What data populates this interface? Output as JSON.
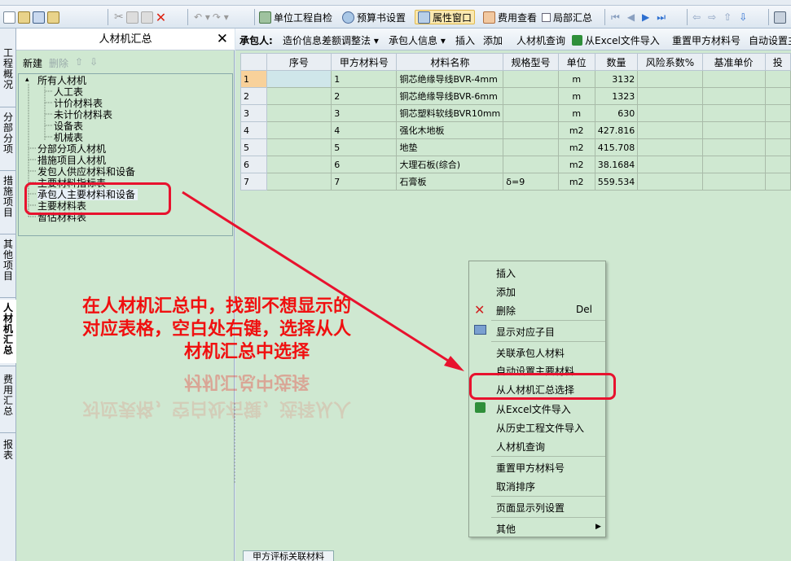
{
  "toolbar": {
    "items": [
      "单位工程自检",
      "预算书设置",
      "属性窗口",
      "费用查看",
      "局部汇总"
    ]
  },
  "side_tabs": [
    "工程概况",
    "分部分项",
    "措施项目",
    "其他项目",
    "人材机汇总",
    "费用汇总",
    "报表"
  ],
  "left_panel": {
    "title": "人材机汇总",
    "close": "✕",
    "new_label": "新建",
    "delete_label": "删除",
    "tree": {
      "root": "所有人材机",
      "children": [
        "人工表",
        "计价材料表",
        "未计价材料表",
        "设备表",
        "机械表"
      ],
      "items": [
        "分部分项人材机",
        "措施项目人材机",
        "发包人供应材料和设备",
        "主要材料指标表",
        "承包人主要材料和设备",
        "主要材料表",
        "暂估材料表"
      ]
    }
  },
  "right_toolbar": {
    "prefix": "承包人:",
    "items": [
      "造价信息差额调整法",
      "承包人信息",
      "插入",
      "添加",
      "人材机查询",
      "从Excel文件导入",
      "重置甲方材料号",
      "自动设置主"
    ]
  },
  "table": {
    "headers": [
      "序号",
      "甲方材料号",
      "材料名称",
      "规格型号",
      "单位",
      "数量",
      "风险系数%",
      "基准单价",
      "投"
    ],
    "rows": [
      {
        "n": "1",
        "code": "1",
        "name": "铜芯绝缘导线BVR-4mm",
        "spec": "",
        "unit": "m",
        "qty": "3132"
      },
      {
        "n": "2",
        "code": "2",
        "name": "铜芯绝缘导线BVR-6mm",
        "spec": "",
        "unit": "m",
        "qty": "1323"
      },
      {
        "n": "3",
        "code": "3",
        "name": "铜芯塑料软线BVR10mm",
        "spec": "",
        "unit": "m",
        "qty": "630"
      },
      {
        "n": "4",
        "code": "4",
        "name": "强化木地板",
        "spec": "",
        "unit": "m2",
        "qty": "427.816"
      },
      {
        "n": "5",
        "code": "5",
        "name": "地垫",
        "spec": "",
        "unit": "m2",
        "qty": "415.708"
      },
      {
        "n": "6",
        "code": "6",
        "name": "大理石板(综合)",
        "spec": "",
        "unit": "m2",
        "qty": "38.1684"
      },
      {
        "n": "7",
        "code": "7",
        "name": "石膏板",
        "spec": "δ=9",
        "unit": "m2",
        "qty": "559.534"
      }
    ]
  },
  "context_menu": {
    "insert": "插入",
    "add": "添加",
    "delete": "删除",
    "delete_shortcut": "Del",
    "show_child": "显示对应子目",
    "link_contractor": "关联承包人材料",
    "auto_main": "自动设置主要材料",
    "select_from_summary": "从人材机汇总选择",
    "import_excel": "从Excel文件导入",
    "import_history": "从历史工程文件导入",
    "query": "人材机查询",
    "reset_code": "重置甲方材料号",
    "cancel_sort": "取消排序",
    "page_columns": "页面显示列设置",
    "other": "其他"
  },
  "bottom_tab": "甲方评标关联材料",
  "annotation": {
    "line1": "在人材机汇总中，找到不想显示的",
    "line2": "对应表格，空白处右键，选择从人",
    "line3": "材机汇总中选择"
  },
  "colors": {
    "highlight": "#e8122e",
    "annotation": "#f01010",
    "panel_bg": "#cfe8d1"
  }
}
